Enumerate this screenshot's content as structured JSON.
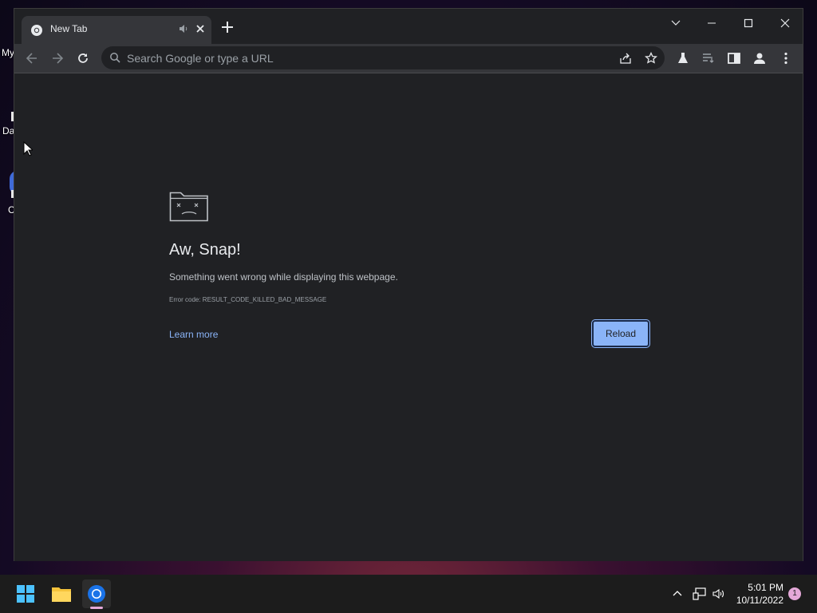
{
  "desktop": {
    "icon_labels": [
      "My",
      "Da",
      "C"
    ]
  },
  "browser": {
    "tab": {
      "title": "New Tab"
    },
    "omnibox": {
      "placeholder": "Search Google or type a URL"
    },
    "crash_page": {
      "title": "Aw, Snap!",
      "description": "Something went wrong while displaying this webpage.",
      "error_code": "Error code: RESULT_CODE_KILLED_BAD_MESSAGE",
      "learn_more": "Learn more",
      "reload_label": "Reload"
    }
  },
  "icons": {
    "tab": [
      "chrome-favicon-icon",
      "audio-speaker-icon",
      "close-icon",
      "new-tab-plus-icon"
    ],
    "window_controls": [
      "tab-search-chevron-icon",
      "minimize-icon",
      "maximize-icon",
      "close-window-icon"
    ],
    "toolbar": [
      "back-arrow-icon",
      "forward-arrow-icon",
      "reload-icon",
      "search-icon",
      "share-icon",
      "bookmark-star-icon",
      "labs-flask-icon",
      "reading-list-icon",
      "side-panel-icon",
      "profile-icon",
      "menu-dots-icon"
    ],
    "taskbar": [
      "windows-start-icon",
      "file-explorer-icon",
      "chrome-icon",
      "chevron-up-icon",
      "network-icon",
      "volume-icon"
    ]
  },
  "taskbar": {
    "time": "5:01 PM",
    "date": "10/11/2022",
    "notification_count": "1"
  },
  "colors": {
    "window_bg": "#202124",
    "toolbar_bg": "#35363a",
    "accent_blue": "#8ab4f8",
    "taskbar_bg": "#1c1c1c",
    "notification_pink": "#e4a8d8"
  }
}
